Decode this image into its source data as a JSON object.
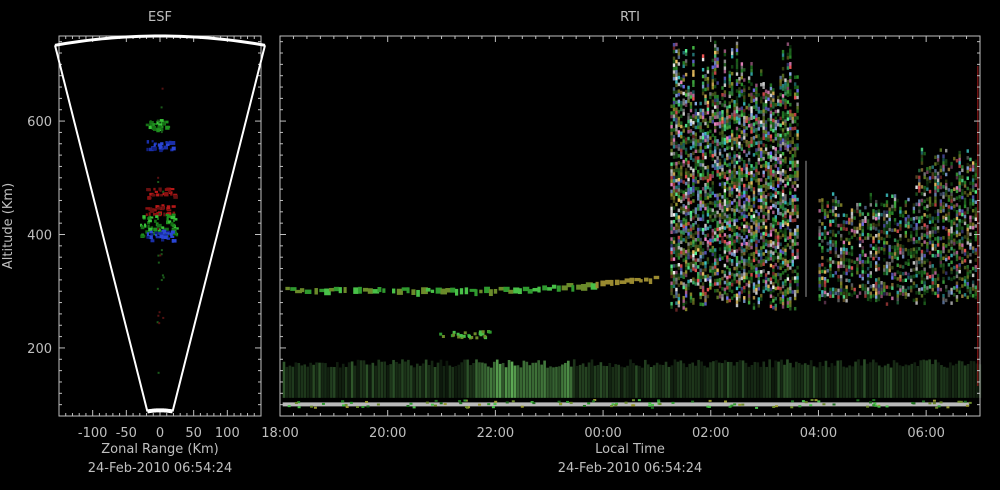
{
  "chart_data": [
    {
      "type": "heatmap",
      "title": "ESF",
      "xlabel": "Zonal Range (Km)",
      "ylabel": "Altitude (Km)",
      "timestamp": "24-Feb-2010 06:54:24",
      "xlim": [
        -150,
        150
      ],
      "ylim": [
        80,
        750
      ],
      "x_ticks": [
        "-100",
        "-50",
        "0",
        "50",
        "100"
      ],
      "x_tick_values": [
        -100,
        -50,
        0,
        50,
        100
      ],
      "y_ticks": [
        "200",
        "400",
        "600"
      ],
      "y_tick_values": [
        200,
        400,
        600
      ],
      "beam_half_angle_deg": 12,
      "range_limits_km": [
        90,
        750
      ],
      "echo_regions": [
        {
          "color": "green",
          "alt_km": 595,
          "x_km": -5
        },
        {
          "color": "blue",
          "alt_km": 560,
          "x_km": -3
        },
        {
          "color": "red",
          "alt_km": 475,
          "x_km": 0
        },
        {
          "color": "red",
          "alt_km": 445,
          "x_km": -2
        },
        {
          "color": "green",
          "alt_km": 418,
          "x_km": -3
        },
        {
          "color": "blue",
          "alt_km": 400,
          "x_km": -2
        }
      ]
    },
    {
      "type": "heatmap",
      "title": "RTI",
      "xlabel": "Local Time",
      "timestamp": "24-Feb-2010 06:54:24",
      "ylim": [
        80,
        750
      ],
      "xlim": [
        "18:00",
        "07:00"
      ],
      "x_ticks": [
        "18:00",
        "20:00",
        "22:00",
        "00:00",
        "02:00",
        "04:00",
        "06:00"
      ],
      "y_tick_values": [
        200,
        400,
        600
      ],
      "features": [
        {
          "name": "F-layer trace",
          "start": "18:00",
          "end": "01:00",
          "alt_km": 305
        },
        {
          "name": "plume 1",
          "start": "01:15",
          "end": "03:35",
          "alt_range_km": [
            270,
            750
          ]
        },
        {
          "name": "plume 2",
          "start": "04:00",
          "end": "07:00",
          "alt_range_km": [
            280,
            550
          ]
        },
        {
          "name": "E-region echoes",
          "start": "18:00",
          "end": "07:00",
          "alt_range_km": [
            90,
            180
          ]
        }
      ]
    }
  ]
}
